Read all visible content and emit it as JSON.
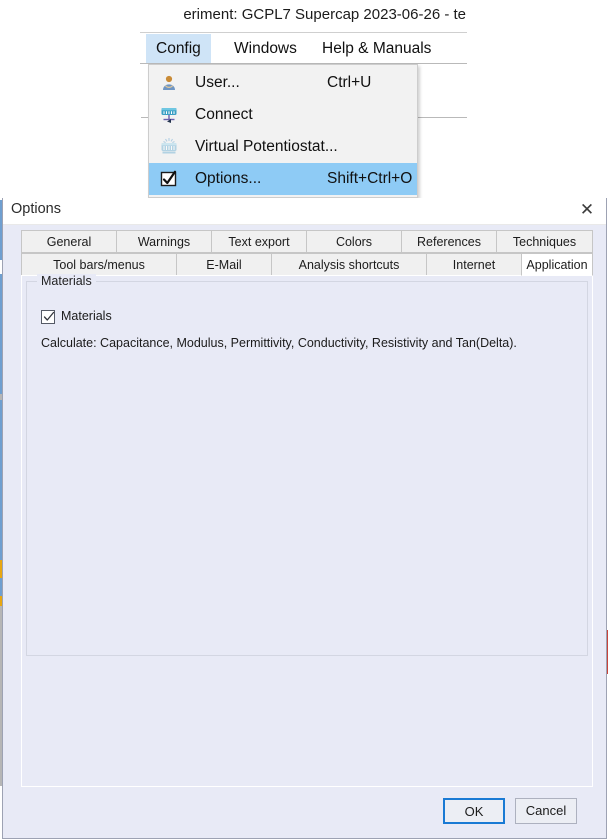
{
  "background_app": {
    "window_title": "eriment: GCPL7 Supercap 2023-06-26 - te",
    "menubar": [
      {
        "label": "Config",
        "active": true
      },
      {
        "label": "Windows",
        "active": false
      },
      {
        "label": "Help & Manuals",
        "active": false
      }
    ]
  },
  "config_menu": {
    "items": [
      {
        "icon": "user-icon",
        "label": "User...",
        "accel": "Ctrl+U",
        "highlighted": false
      },
      {
        "icon": "connect-icon",
        "label": "Connect",
        "accel": "",
        "highlighted": false
      },
      {
        "icon": "virtual-potentiostat-icon",
        "label": "Virtual Potentiostat...",
        "accel": "",
        "highlighted": false
      },
      {
        "icon": "options-checkbox-icon",
        "label": "Options...",
        "accel": "Shift+Ctrl+O",
        "highlighted": true
      }
    ]
  },
  "dialog": {
    "title": "Options",
    "close_label": "✕",
    "tabs_row1": [
      {
        "label": "General",
        "selected": false
      },
      {
        "label": "Warnings",
        "selected": false
      },
      {
        "label": "Text export",
        "selected": false
      },
      {
        "label": "Colors",
        "selected": false
      },
      {
        "label": "References",
        "selected": false
      },
      {
        "label": "Techniques",
        "selected": false
      }
    ],
    "tabs_row2": [
      {
        "label": "Tool bars/menus",
        "selected": false
      },
      {
        "label": "E-Mail",
        "selected": false
      },
      {
        "label": "Analysis shortcuts",
        "selected": false
      },
      {
        "label": "Internet",
        "selected": false
      },
      {
        "label": "Application",
        "selected": true
      }
    ],
    "application_tab": {
      "group_title": "Materials",
      "checkbox_label": "Materials",
      "checkbox_checked": true,
      "description": "Calculate: Capacitance, Modulus, Permittivity, Conductivity, Resistivity and Tan(Delta)."
    },
    "buttons": {
      "ok": "OK",
      "cancel": "Cancel"
    }
  },
  "colors": {
    "dialog_background": "#e8eaf6",
    "menu_highlight": "#8ecbf5",
    "menubar_active": "#cfe4f7",
    "default_button_border": "#1a7ad4",
    "tab_face": "#f0f0f0",
    "tab_selected": "#ffffff"
  }
}
